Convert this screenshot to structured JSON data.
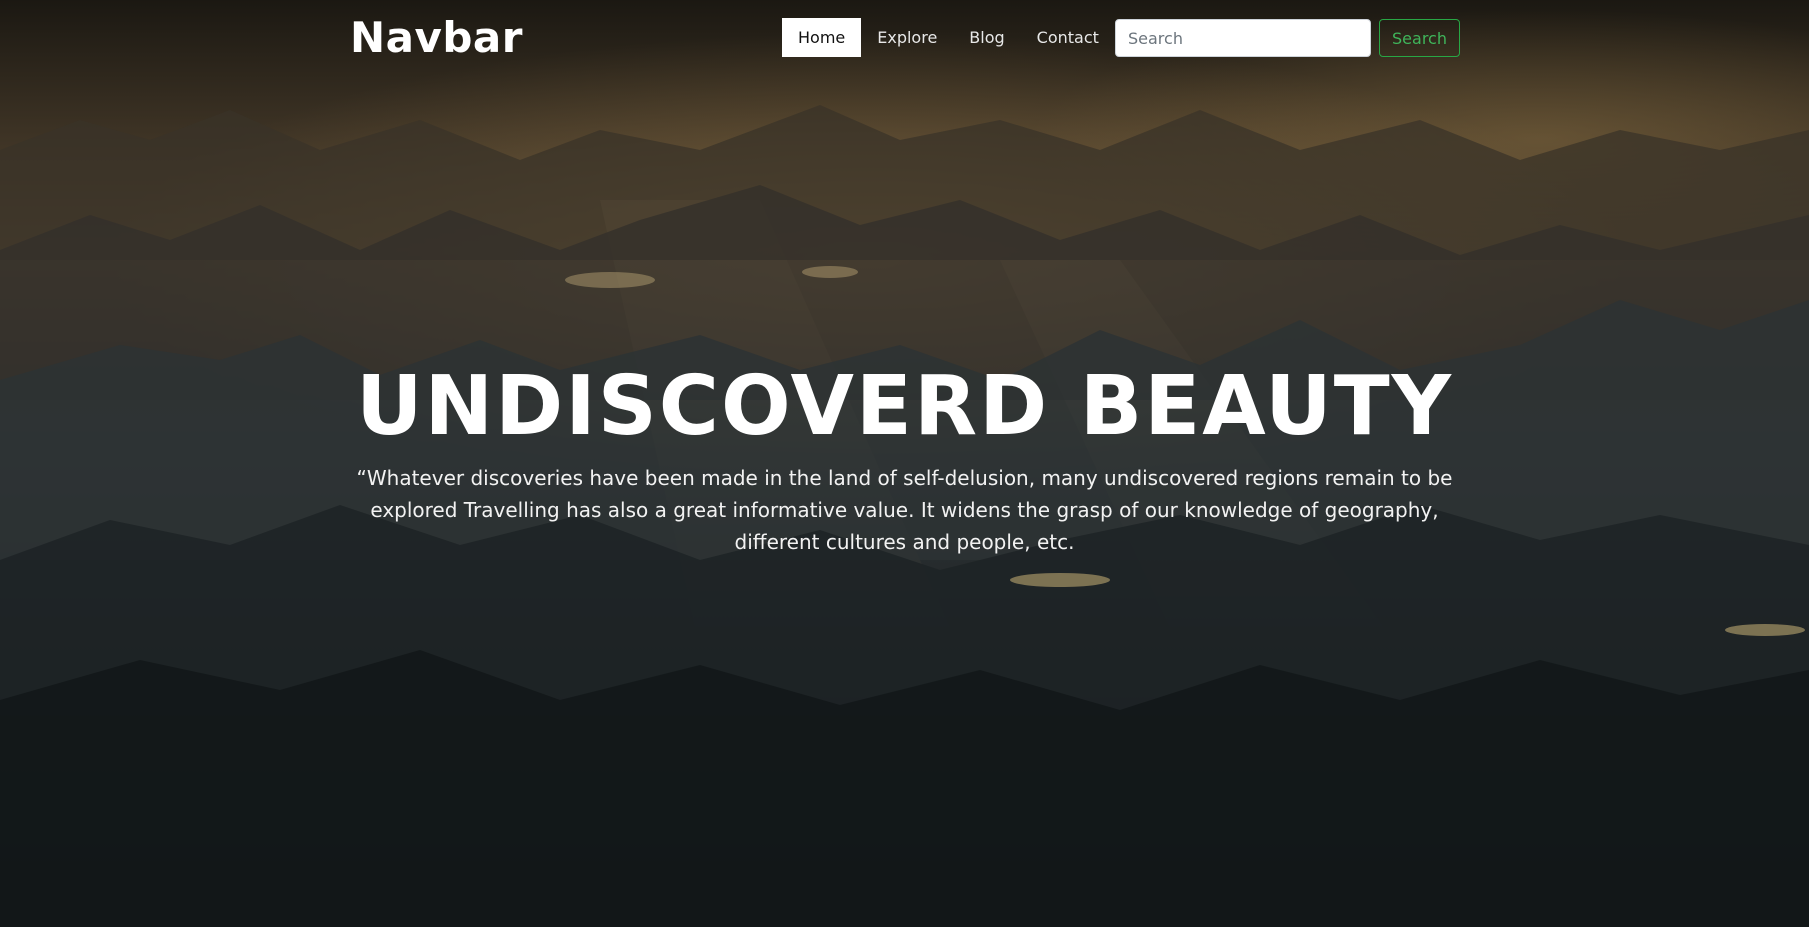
{
  "navbar": {
    "brand": "Navbar",
    "links": [
      {
        "label": "Home",
        "active": true
      },
      {
        "label": "Explore",
        "active": false
      },
      {
        "label": "Blog",
        "active": false
      },
      {
        "label": "Contact",
        "active": false
      }
    ],
    "search": {
      "placeholder": "Search",
      "value": "",
      "button_label": "Search"
    }
  },
  "hero": {
    "headline": "UNDISCOVERD BEAUTY",
    "quote": "“Whatever discoveries have been made in the land of self-delusion, many undiscovered regions remain to be explored Travelling has also a great informative value. It widens the grasp of our knowledge of geography, different cultures and people, etc.",
    "background_image": "mountain-range-landscape"
  },
  "colors": {
    "accent_green": "#28a745",
    "active_link_bg": "#ffffff",
    "text_light": "#ffffff"
  }
}
